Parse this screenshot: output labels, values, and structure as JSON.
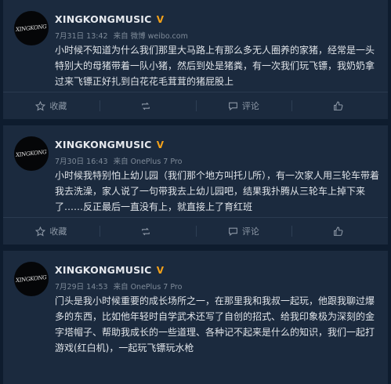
{
  "posts": [
    {
      "avatar_text": "XINGKONG",
      "username": "XINGKONGMUSIC",
      "date": "7月31日 13:42",
      "source": "来自 微博 weibo.com",
      "content": "小时候不知道为什么我们那里大马路上有那么多无人圈养的家猪，经常是一头特别大的母猪带着一队小猪，然后到处是猪粪，有一次我们玩飞镖，我奶奶拿过来飞镖正好扎到白花花毛茸茸的猪屁股上"
    },
    {
      "avatar_text": "XINGKONG",
      "username": "XINGKONGMUSIC",
      "date": "7月30日 16:43",
      "source": "来自 OnePlus 7 Pro",
      "content": "小时候我特别怕上幼儿园（我们那个地方叫托儿所），有一次家人用三轮车带着我去洗澡，家人说了一句带我去上幼儿园吧，结果我扑腾从三轮车上掉下来了……反正最后一直没有上，就直接上了育红班"
    },
    {
      "avatar_text": "XINGKONG",
      "username": "XINGKONGMUSIC",
      "date": "7月29日 14:53",
      "source": "来自 OnePlus 7 Pro",
      "content": "门头是我小时候重要的成长场所之一，在那里我和我叔一起玩，他跟我聊过爆多的东西，比如他年轻时自学武术还写了自创的招式、给我印象极为深刻的金字塔帽子、帮助我成长的一些道理、各种记不起来是什么的知识，我们一起打游戏(红白机)，一起玩飞镖玩水枪"
    }
  ],
  "actions": {
    "favorite": "收藏",
    "repost": "",
    "comment": "评论",
    "like": ""
  },
  "colors": {
    "background": "#0e1c2e",
    "card": "#1b2a3e",
    "verified_badge": "#f3a11a",
    "text": "#dfe3e8"
  }
}
